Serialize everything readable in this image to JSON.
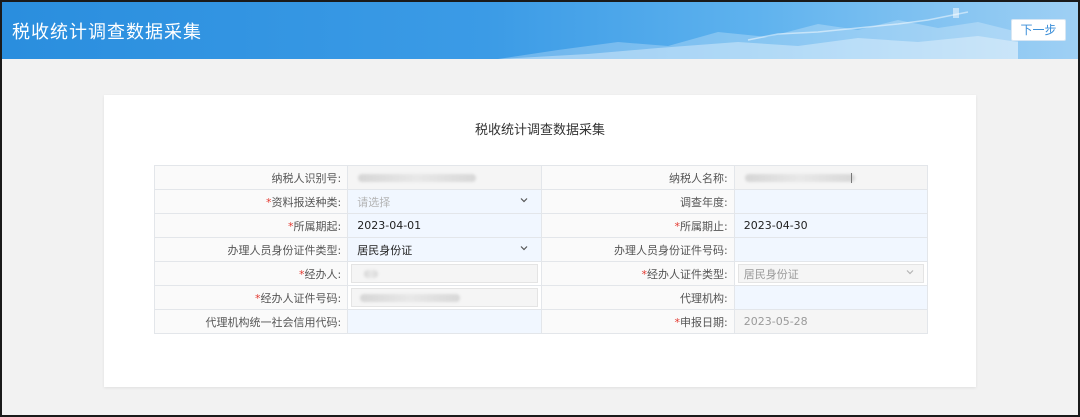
{
  "header": {
    "title": "税收统计调查数据采集",
    "next_button": "下一步"
  },
  "form": {
    "title": "税收统计调查数据采集",
    "rows": [
      [
        {
          "label": "纳税人识别号:",
          "required": false,
          "value": "",
          "blurred": true
        },
        {
          "label": "纳税人名称:",
          "required": false,
          "value": "",
          "blurred": true
        }
      ],
      [
        {
          "label": "资料报送种类:",
          "required": true,
          "placeholder": "请选择",
          "type": "select"
        },
        {
          "label": "调查年度:",
          "required": false,
          "value": ""
        }
      ],
      [
        {
          "label": "所属期起:",
          "required": true,
          "value": "2023-04-01"
        },
        {
          "label": "所属期止:",
          "required": true,
          "value": "2023-04-30"
        }
      ],
      [
        {
          "label": "办理人员身份证件类型:",
          "required": false,
          "value": "居民身份证",
          "type": "select"
        },
        {
          "label": "办理人员身份证件号码:",
          "required": false,
          "value": ""
        }
      ],
      [
        {
          "label": "经办人:",
          "required": true,
          "value": "",
          "blurred": true
        },
        {
          "label": "经办人证件类型:",
          "required": true,
          "value": "居民身份证",
          "type": "select",
          "disabled": true
        }
      ],
      [
        {
          "label": "经办人证件号码:",
          "required": true,
          "value": "",
          "blurred": true
        },
        {
          "label": "代理机构:",
          "required": false,
          "value": ""
        }
      ],
      [
        {
          "label": "代理机构统一社会信用代码:",
          "required": false,
          "value": ""
        },
        {
          "label": "申报日期:",
          "required": true,
          "value": "2023-05-28",
          "disabled": true
        }
      ]
    ]
  },
  "colors": {
    "header_start": "#2a8ede",
    "header_end": "#9fd0f4",
    "required": "#e3382f",
    "editable_bg": "#f1f7ff",
    "readonly_bg": "#f5f5f5"
  },
  "icons": {
    "select": "chevron-down-icon",
    "header_decoration": "great-wall-mountain-icon"
  }
}
